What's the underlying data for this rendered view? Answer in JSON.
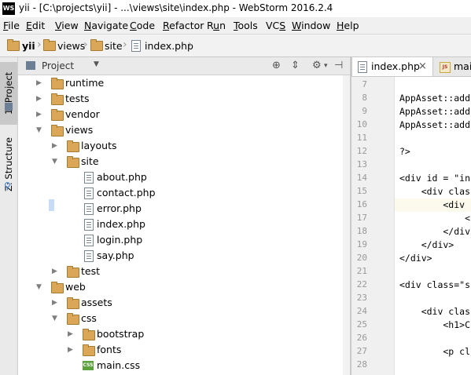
{
  "window": {
    "app_icon": "WS",
    "title": "yii - [C:\\projects\\yii] - ...\\views\\site\\index.php - WebStorm 2016.2.4"
  },
  "menu": [
    {
      "label": "File",
      "mnemonic": "F"
    },
    {
      "label": "Edit",
      "mnemonic": "E"
    },
    {
      "label": "View",
      "mnemonic": "V"
    },
    {
      "label": "Navigate",
      "mnemonic": "N"
    },
    {
      "label": "Code",
      "mnemonic": "C"
    },
    {
      "label": "Refactor",
      "mnemonic": "R"
    },
    {
      "label": "Run",
      "mnemonic": "u"
    },
    {
      "label": "Tools",
      "mnemonic": "T"
    },
    {
      "label": "VCS",
      "mnemonic": "S"
    },
    {
      "label": "Window",
      "mnemonic": "W"
    },
    {
      "label": "Help",
      "mnemonic": "H"
    }
  ],
  "breadcrumb": [
    "yii",
    "views",
    "site",
    "index.php"
  ],
  "tool_windows": {
    "project": "1: Project",
    "structure": "Z: Structure"
  },
  "project_panel": {
    "view_label": "Project",
    "icons": [
      "target-icon",
      "collapse-icon",
      "gear-icon",
      "hide-icon"
    ]
  },
  "tree": [
    {
      "label": "runtime",
      "type": "folder",
      "depth": 1,
      "state": "collapsed"
    },
    {
      "label": "tests",
      "type": "folder",
      "depth": 1,
      "state": "collapsed"
    },
    {
      "label": "vendor",
      "type": "folder",
      "depth": 1,
      "state": "collapsed"
    },
    {
      "label": "views",
      "type": "folder",
      "depth": 1,
      "state": "expanded"
    },
    {
      "label": "layouts",
      "type": "folder",
      "depth": 2,
      "state": "collapsed"
    },
    {
      "label": "site",
      "type": "folder",
      "depth": 2,
      "state": "expanded"
    },
    {
      "label": "about.php",
      "type": "file",
      "depth": 3
    },
    {
      "label": "contact.php",
      "type": "file",
      "depth": 3
    },
    {
      "label": "error.php",
      "type": "file",
      "depth": 3
    },
    {
      "label": "index.php",
      "type": "file",
      "depth": 3
    },
    {
      "label": "login.php",
      "type": "file",
      "depth": 3
    },
    {
      "label": "say.php",
      "type": "file",
      "depth": 3
    },
    {
      "label": "test",
      "type": "folder",
      "depth": 2,
      "state": "collapsed"
    },
    {
      "label": "web",
      "type": "folder",
      "depth": 1,
      "state": "expanded"
    },
    {
      "label": "assets",
      "type": "folder",
      "depth": 2,
      "state": "collapsed"
    },
    {
      "label": "css",
      "type": "folder",
      "depth": 2,
      "state": "expanded"
    },
    {
      "label": "bootstrap",
      "type": "folder",
      "depth": 3,
      "state": "collapsed"
    },
    {
      "label": "fonts",
      "type": "folder",
      "depth": 3,
      "state": "collapsed"
    },
    {
      "label": "main.css",
      "type": "css",
      "depth": 3,
      "icon_text": "CSS"
    }
  ],
  "editor_tabs": [
    {
      "label": "index.php",
      "active": true,
      "close": "×"
    },
    {
      "label": "main",
      "active": false,
      "icon_text": "JS"
    }
  ],
  "editor": {
    "lines": [
      {
        "n": "7",
        "text": ""
      },
      {
        "n": "8",
        "text": "AppAsset::add"
      },
      {
        "n": "9",
        "text": "AppAsset::add"
      },
      {
        "n": "10",
        "text": "AppAsset::add"
      },
      {
        "n": "11",
        "text": ""
      },
      {
        "n": "12",
        "text": "?>"
      },
      {
        "n": "13",
        "text": ""
      },
      {
        "n": "14",
        "text": "<div id = \"in"
      },
      {
        "n": "15",
        "text": "    <div clas"
      },
      {
        "n": "16",
        "text": "        <div "
      },
      {
        "n": "17",
        "text": "            <"
      },
      {
        "n": "18",
        "text": "        </div"
      },
      {
        "n": "19",
        "text": "    </div>"
      },
      {
        "n": "20",
        "text": "</div>"
      },
      {
        "n": "21",
        "text": ""
      },
      {
        "n": "22",
        "text": "<div class=\"s"
      },
      {
        "n": "23",
        "text": ""
      },
      {
        "n": "24",
        "text": "    <div clas"
      },
      {
        "n": "25",
        "text": "        <h1>C"
      },
      {
        "n": "26",
        "text": ""
      },
      {
        "n": "27",
        "text": "        <p cl"
      },
      {
        "n": "28",
        "text": ""
      }
    ],
    "current_line": "16"
  }
}
